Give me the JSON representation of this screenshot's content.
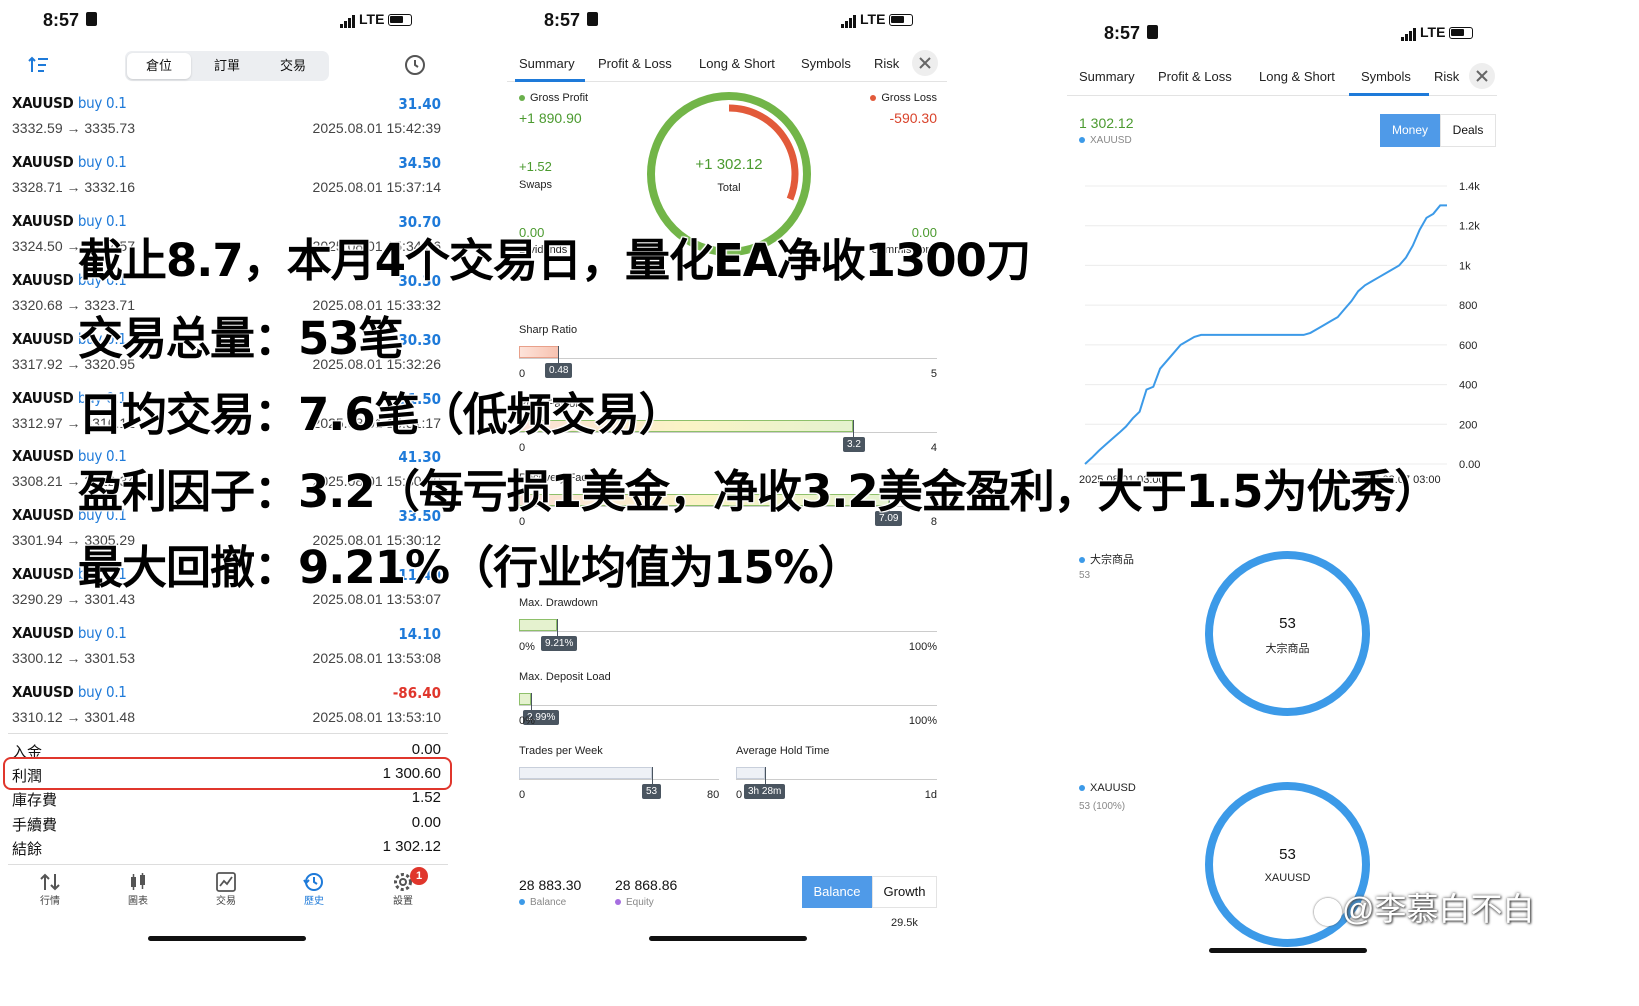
{
  "status": {
    "time": "8:57",
    "network": "LTE"
  },
  "panel1": {
    "segments": [
      "倉位",
      "訂單",
      "交易"
    ],
    "trades": [
      {
        "symbol": "XAUUSD",
        "side": "buy 0.1",
        "prices": "3332.59 → 3335.73",
        "pl": "31.40",
        "time": "2025.08.01 15:42:39"
      },
      {
        "symbol": "XAUUSD",
        "side": "buy 0.1",
        "prices": "3328.71 → 3332.16",
        "pl": "34.50",
        "time": "2025.08.01 15:37:14"
      },
      {
        "symbol": "XAUUSD",
        "side": "buy 0.1",
        "prices": "3324.50 → 3327.57",
        "pl": "30.70",
        "time": "2025.08.01 15:34:36"
      },
      {
        "symbol": "XAUUSD",
        "side": "buy 0.1",
        "prices": "3320.68 → 3323.71",
        "pl": "30.30",
        "time": "2025.08.01 15:33:32"
      },
      {
        "symbol": "XAUUSD",
        "side": "buy 0.1",
        "prices": "3317.92 → 3320.95",
        "pl": "30.30",
        "time": "2025.08.01 15:32:26"
      },
      {
        "symbol": "XAUUSD",
        "side": "buy 0.1",
        "prices": "3312.97 → 3316.12",
        "pl": "31.50",
        "time": "2025.08.01 15:31:17"
      },
      {
        "symbol": "XAUUSD",
        "side": "buy 0.1",
        "prices": "3308.21 → 3312.34",
        "pl": "41.30",
        "time": "2025.08.01 15:30:20"
      },
      {
        "symbol": "XAUUSD",
        "side": "buy 0.1",
        "prices": "3301.94 → 3305.29",
        "pl": "33.50",
        "time": "2025.08.01 15:30:12"
      },
      {
        "symbol": "XAUUSD",
        "side": "buy 0.1",
        "prices": "3290.29 → 3301.43",
        "pl": "111.40",
        "time": "2025.08.01 13:53:07"
      },
      {
        "symbol": "XAUUSD",
        "side": "buy 0.1",
        "prices": "3300.12 → 3301.53",
        "pl": "14.10",
        "time": "2025.08.01 13:53:08"
      },
      {
        "symbol": "XAUUSD",
        "side": "buy 0.1",
        "prices": "3310.12 → 3301.48",
        "pl": "-86.40",
        "time": "2025.08.01 13:53:10"
      }
    ],
    "summary": [
      {
        "label": "入金",
        "value": "0.00"
      },
      {
        "label": "利潤",
        "value": "1 300.60"
      },
      {
        "label": "庫存費",
        "value": "1.52"
      },
      {
        "label": "手續費",
        "value": "0.00"
      },
      {
        "label": "結餘",
        "value": "1 302.12"
      }
    ],
    "nav": [
      "行情",
      "圖表",
      "交易",
      "歷史",
      "設置"
    ],
    "settings_badge": "1",
    "accent": "#1e7ad9"
  },
  "panel2": {
    "tabs": [
      "Summary",
      "Profit & Loss",
      "Long & Short",
      "Symbols",
      "Risk"
    ],
    "gross_profit_label": "Gross Profit",
    "gross_profit": "+1 890.90",
    "gross_loss_label": "Gross Loss",
    "gross_loss": "-590.30",
    "swaps_value": "+1.52",
    "swaps_label": "Swaps",
    "dividends_value": "0.00",
    "dividends_label": "Dividends",
    "commissions_value": "0.00",
    "commissions_label": "Commissions",
    "total_value": "+1 302.12",
    "total_label": "Total",
    "gross_profit_amount": 1890.9,
    "gross_loss_amount": 590.3,
    "sharp_label": "Sharp Ratio",
    "sharp": {
      "value": "0.48",
      "min": "0",
      "max": "5"
    },
    "profit_factor_label": "Profit Factor",
    "profit_factor": {
      "value": "3.2",
      "min": "0",
      "max": "4"
    },
    "recovery_label": "Recovery Factor",
    "recovery": {
      "value": "7.09",
      "min": "0",
      "max": "8"
    },
    "drawdown_label": "Max. Drawdown",
    "drawdown": {
      "value": "9.21%",
      "min": "0%",
      "max": "100%"
    },
    "deposit_label": "Max. Deposit Load",
    "deposit": {
      "value": "2.99%",
      "min": "0%",
      "max": "100%"
    },
    "tpw_label": "Trades per Week",
    "tpw": {
      "value": "53",
      "min": "0",
      "max": "80"
    },
    "aht_label": "Average Hold Time",
    "aht": {
      "value": "3h 28m",
      "min": "0",
      "max": "1d"
    },
    "balance_value": "28 883.30",
    "balance_label": "Balance",
    "equity_value": "28 868.86",
    "equity_label": "Equity",
    "btn_balance": "Balance",
    "btn_growth": "Growth",
    "axis_top": "29.5k"
  },
  "panel3": {
    "tabs": [
      "Summary",
      "Profit & Loss",
      "Long & Short",
      "Symbols",
      "Risk"
    ],
    "value": "1 302.12",
    "symbol": "XAUUSD",
    "btn_money": "Money",
    "btn_deals": "Deals",
    "cat1_label": "大宗商品",
    "cat1_count": "53",
    "ring1_value": "53",
    "ring1_label": "大宗商品",
    "cat2_label": "XAUUSD",
    "cat2_count": "53 (100%)",
    "ring2_value": "53",
    "ring2_label": "XAUUSD",
    "ring_color": "#3c9ae8"
  },
  "chart_data": {
    "type": "line",
    "yticks": [
      "1.4k",
      "1.2k",
      "1k",
      "800",
      "600",
      "400",
      "200",
      "0.00"
    ],
    "ylim": [
      0,
      1400
    ],
    "xlabels": [
      "2025.08.01 03:00",
      "2025.08.07 03:00"
    ],
    "x": [
      0,
      1,
      2,
      3,
      4,
      5,
      6,
      7,
      8,
      9,
      10,
      11,
      12,
      13,
      14,
      15,
      16,
      17,
      18,
      19,
      20,
      21,
      22,
      23,
      24,
      25,
      26,
      27,
      28,
      29,
      30,
      31,
      32,
      33,
      34,
      35,
      36,
      37,
      38,
      39,
      40,
      41,
      42,
      43,
      44,
      45,
      46,
      47,
      48,
      49,
      50,
      51,
      52,
      53
    ],
    "values": [
      0,
      31.4,
      65.9,
      96.6,
      126.9,
      157.2,
      188.7,
      230.0,
      263.5,
      374.9,
      389.0,
      480,
      520,
      560,
      600,
      620,
      640,
      650,
      650,
      650,
      650,
      650,
      650,
      650,
      650,
      650,
      650,
      650,
      650,
      650,
      650,
      650,
      650,
      660,
      680,
      700,
      720,
      740,
      780,
      820,
      870,
      900,
      920,
      940,
      960,
      980,
      1000,
      1040,
      1100,
      1180,
      1240,
      1260,
      1302.12,
      1302.12
    ],
    "series": [
      {
        "name": "",
        "color": "#3c9ae8"
      }
    ]
  },
  "watermark": "@李慕白不白",
  "overlay_lines": [
    "截止8.7，本月4个交易日，量化EA净收1300刀",
    "交易总量：53笔",
    "日均交易：7.6笔（低频交易）",
    "盈利因子：3.2（每亏损1美金，净收3.2美金盈利，大于1.5为优秀）",
    "最大回撤：9.21%（行业均值为15%）"
  ]
}
